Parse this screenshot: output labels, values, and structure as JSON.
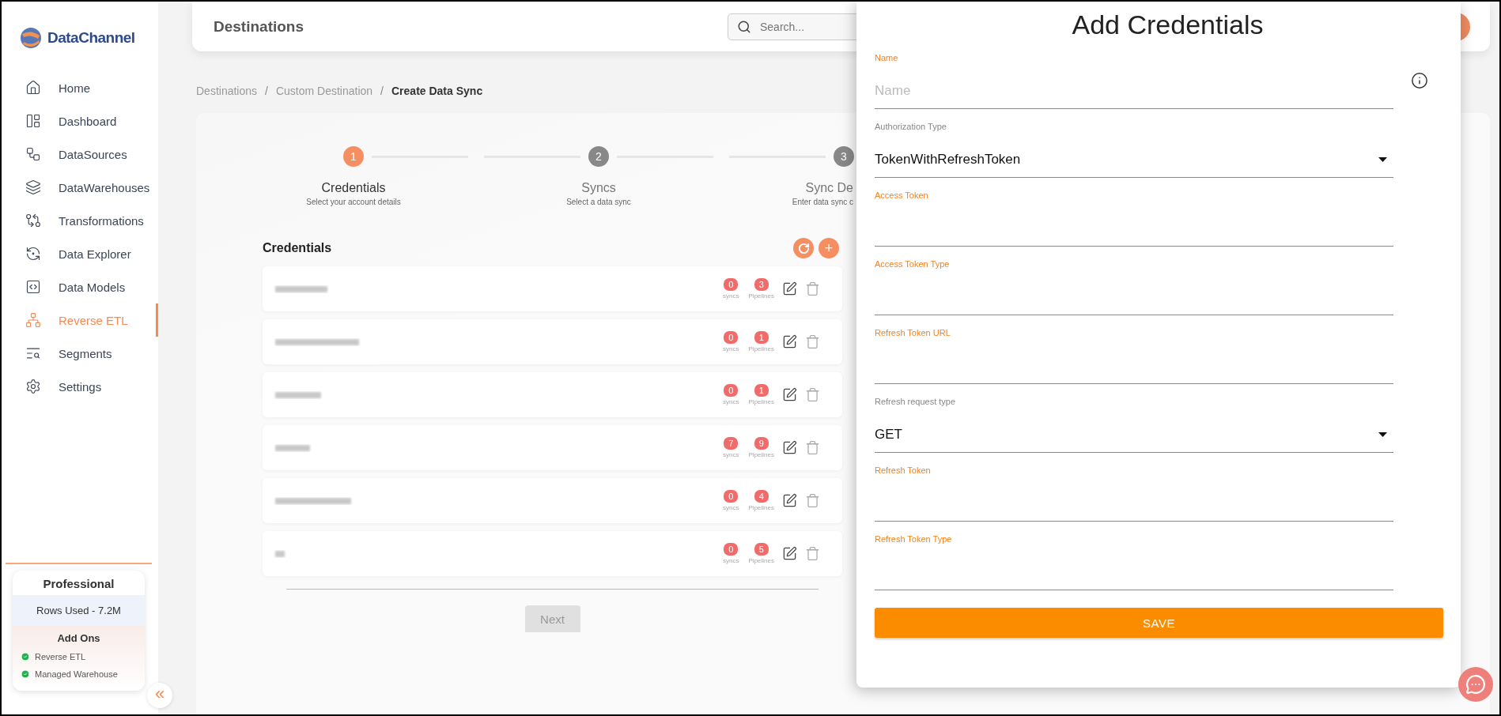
{
  "sidebar": {
    "logo": "DataChannel",
    "items": [
      {
        "label": "Home",
        "selected": false
      },
      {
        "label": "Dashboard",
        "selected": false
      },
      {
        "label": "DataSources",
        "selected": false
      },
      {
        "label": "DataWarehouses",
        "selected": false
      },
      {
        "label": "Transformations",
        "selected": false
      },
      {
        "label": "Data Explorer",
        "selected": false
      },
      {
        "label": "Data Models",
        "selected": false
      },
      {
        "label": "Reverse ETL",
        "selected": true
      },
      {
        "label": "Segments",
        "selected": false
      },
      {
        "label": "Settings",
        "selected": false
      }
    ],
    "plan": {
      "title": "Professional",
      "usage": "Rows Used - 7.2M",
      "addons_title": "Add Ons",
      "addons": [
        "Reverse ETL",
        "Managed Warehouse"
      ]
    },
    "collapse": "«"
  },
  "header": {
    "title": "Destinations",
    "search": {
      "placeholder": "Search..."
    }
  },
  "breadcrumb": [
    {
      "label": "Destinations",
      "current": false
    },
    {
      "label": "Custom Destination",
      "current": false
    },
    {
      "label": "Create Data Sync",
      "current": true
    }
  ],
  "breadcrumb_separator": "/",
  "stepper": [
    {
      "number": "1",
      "title": "Credentials",
      "subtitle": "Select your account details",
      "selected": true
    },
    {
      "number": "2",
      "title": "Syncs",
      "subtitle": "Select a data sync",
      "selected": false
    },
    {
      "number": "3",
      "title": "Sync De",
      "subtitle": "Enter data sync c",
      "selected": false
    }
  ],
  "credentials": {
    "title": "Credentials",
    "add_button": "+",
    "rows": [
      {
        "syncs": "0",
        "syncs_label": "syncs",
        "pipelines": "3",
        "pipelines_label": "Pipelines"
      },
      {
        "syncs": "0",
        "syncs_label": "syncs",
        "pipelines": "1",
        "pipelines_label": "Pipelines"
      },
      {
        "syncs": "0",
        "syncs_label": "syncs",
        "pipelines": "1",
        "pipelines_label": "Pipelines"
      },
      {
        "syncs": "7",
        "syncs_label": "syncs",
        "pipelines": "9",
        "pipelines_label": "Pipelines"
      },
      {
        "syncs": "0",
        "syncs_label": "syncs",
        "pipelines": "4",
        "pipelines_label": "Pipelines"
      },
      {
        "syncs": "0",
        "syncs_label": "syncs",
        "pipelines": "5",
        "pipelines_label": "Pipelines"
      }
    ]
  },
  "next_button": {
    "label": "Next",
    "disabled": true
  },
  "drawer": {
    "title": "Add Credentials",
    "fields": [
      {
        "kind": "text",
        "label": "Name",
        "placeholder": "Name"
      },
      {
        "kind": "select",
        "label": "Authorization Type",
        "value": "TokenWithRefreshToken"
      },
      {
        "kind": "text",
        "label": "Access Token"
      },
      {
        "kind": "text",
        "label": "Access Token Type"
      },
      {
        "kind": "text",
        "label": "Refresh Token URL"
      },
      {
        "kind": "select",
        "label": "Refresh request type",
        "value": "GET"
      },
      {
        "kind": "text",
        "label": "Refresh Token"
      },
      {
        "kind": "text",
        "label": "Refresh Token Type"
      }
    ],
    "save_button": "SAVE"
  }
}
